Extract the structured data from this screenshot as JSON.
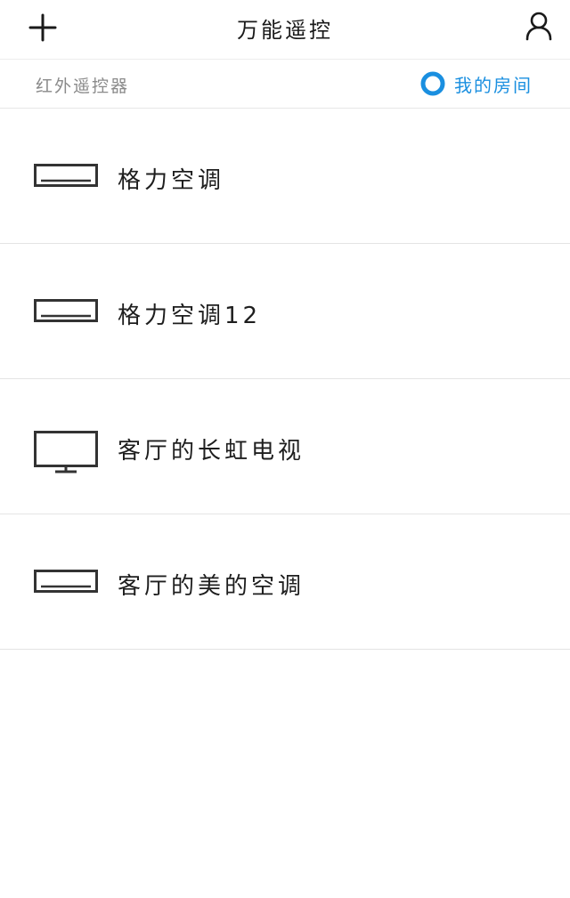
{
  "header": {
    "title": "万能遥控",
    "add_icon": "plus-icon",
    "user_icon": "user-icon"
  },
  "subbar": {
    "subtitle": "红外遥控器",
    "room_label": "我的房间",
    "room_icon": "radio-circle-icon",
    "accent_color": "#1a8fe0"
  },
  "devices": [
    {
      "name": "格力空调",
      "icon": "air-conditioner-icon"
    },
    {
      "name": "格力空调12",
      "icon": "air-conditioner-icon"
    },
    {
      "name": "客厅的长虹电视",
      "icon": "tv-icon"
    },
    {
      "name": "客厅的美的空调",
      "icon": "air-conditioner-icon"
    }
  ]
}
